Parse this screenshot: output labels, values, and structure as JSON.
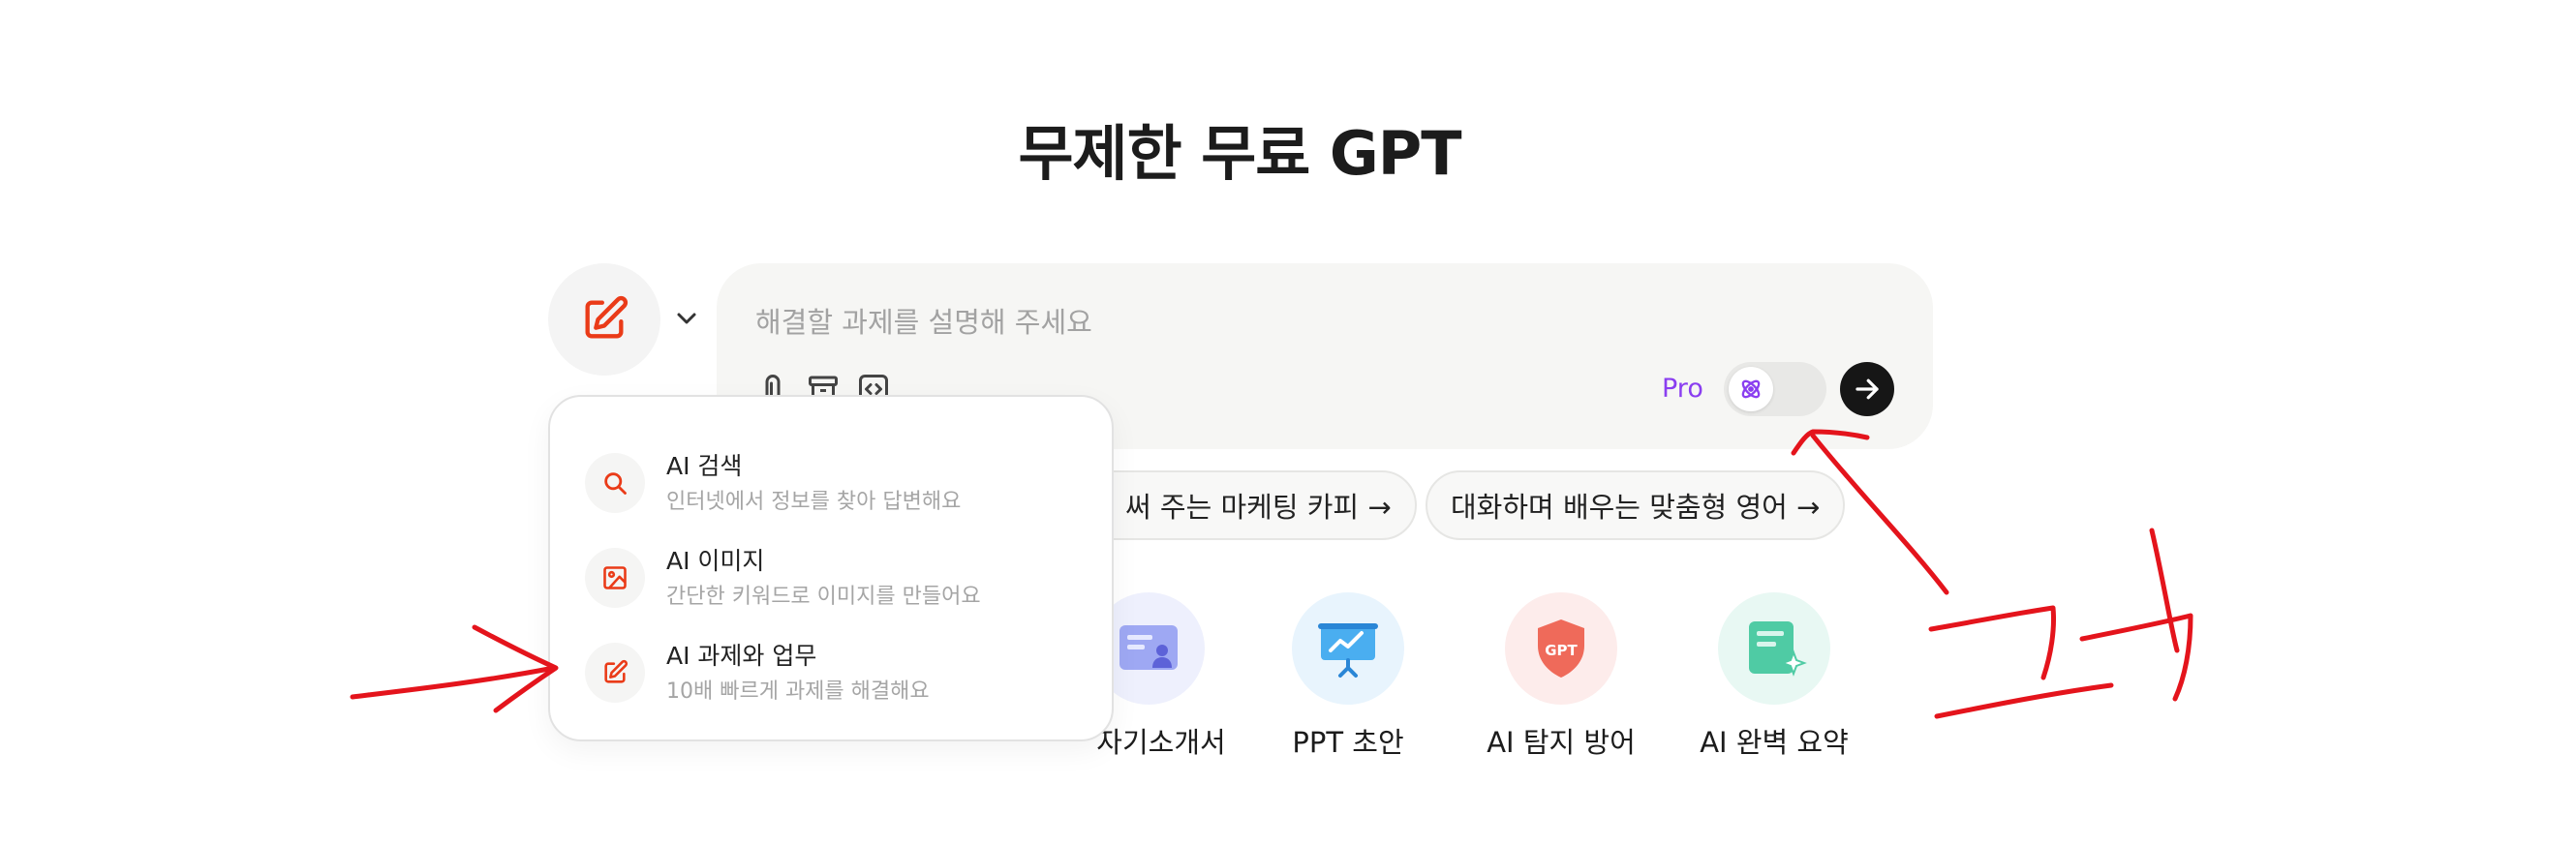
{
  "header": {
    "title": "무제한 무료 GPT"
  },
  "mode_selector": {
    "icon": "edit-icon",
    "chevron": "chevron-down-icon",
    "accent": "#ea3b18"
  },
  "input": {
    "placeholder": "해결할 과제를 설명해 주세요",
    "tools": [
      "paperclip-icon",
      "archive-icon",
      "code-icon"
    ],
    "pro_label": "Pro",
    "pro_color": "#8a3ef0",
    "toggle_icon": "atom-icon",
    "send_icon": "arrow-right-icon"
  },
  "suggestions": [
    {
      "label": "써 주는 마케팅 카피 →"
    },
    {
      "label": "대화하며 배우는 맞춤형 영어 →"
    }
  ],
  "tools_row": [
    {
      "label": "자기소개서",
      "icon": "profile-card-icon",
      "bg": "#eef0fd"
    },
    {
      "label": "PPT 초안",
      "icon": "presentation-icon",
      "bg": "#e8f4fd"
    },
    {
      "label": "AI 탐지 방어",
      "icon": "gpt-shield-icon",
      "badge": "GPT",
      "bg": "#fdeceb"
    },
    {
      "label": "AI 완벽 요약",
      "icon": "summary-doc-icon",
      "bg": "#e8f8f3"
    }
  ],
  "dropdown": {
    "items": [
      {
        "title": "AI 검색",
        "desc": "인터넷에서 정보를 찾아 답변해요",
        "icon": "search-icon"
      },
      {
        "title": "AI 이미지",
        "desc": "간단한 키워드로 이미지를 만들어요",
        "icon": "image-icon"
      },
      {
        "title": "AI 과제와 업무",
        "desc": "10배 빠르게 과제를 해결해요",
        "icon": "edit-icon"
      }
    ]
  },
  "annotation": {
    "handwritten_text": "크기",
    "color": "#e4141c"
  }
}
